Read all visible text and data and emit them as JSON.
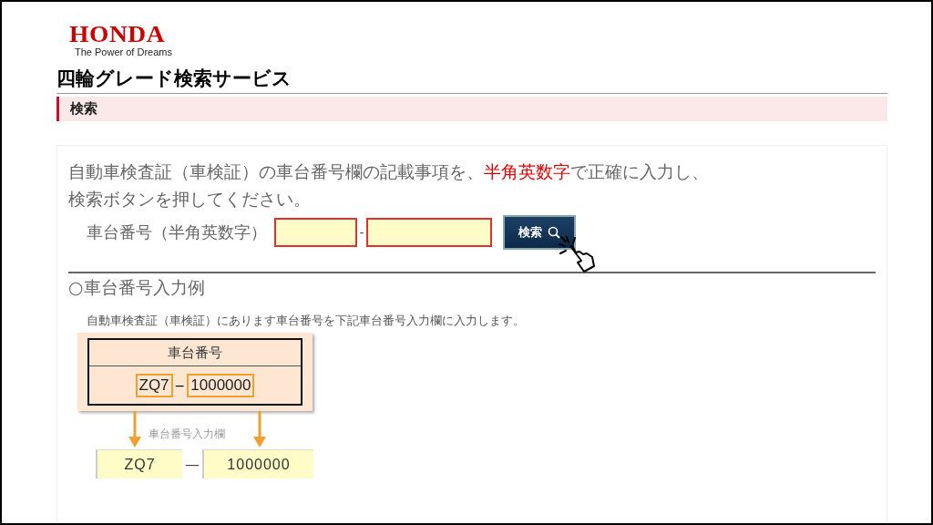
{
  "header": {
    "logo": "HONDA",
    "tagline": "The Power of Dreams"
  },
  "page_title": "四輪グレード検索サービス",
  "section": {
    "title": "検索"
  },
  "instructions": {
    "lines": [
      {
        "text": "自動車検査証（車検証）の車台番号欄の記載事項を、",
        "highlight": "半角英数字",
        "after": "で正確に入力し、"
      },
      {
        "text": "検索ボタンを押してください。"
      }
    ]
  },
  "search_form": {
    "label": "車台番号（半角英数字）",
    "fields": [
      {
        "required": true
      },
      {
        "required": true
      }
    ],
    "separator": "-",
    "button": "検索"
  },
  "example": {
    "heading": "○車台番号入力例",
    "note": "自動車検査証（車検証）にあります車台番号を下記車台番号入力欄に入力します。",
    "diagram": {
      "header": "車台番号",
      "part1": "ZQ7",
      "separator": "−",
      "part2": "1000000",
      "caption": "車台番号入力欄"
    },
    "result": {
      "part1": "ZQ7",
      "separator": "—",
      "part2": "1000000"
    }
  }
}
